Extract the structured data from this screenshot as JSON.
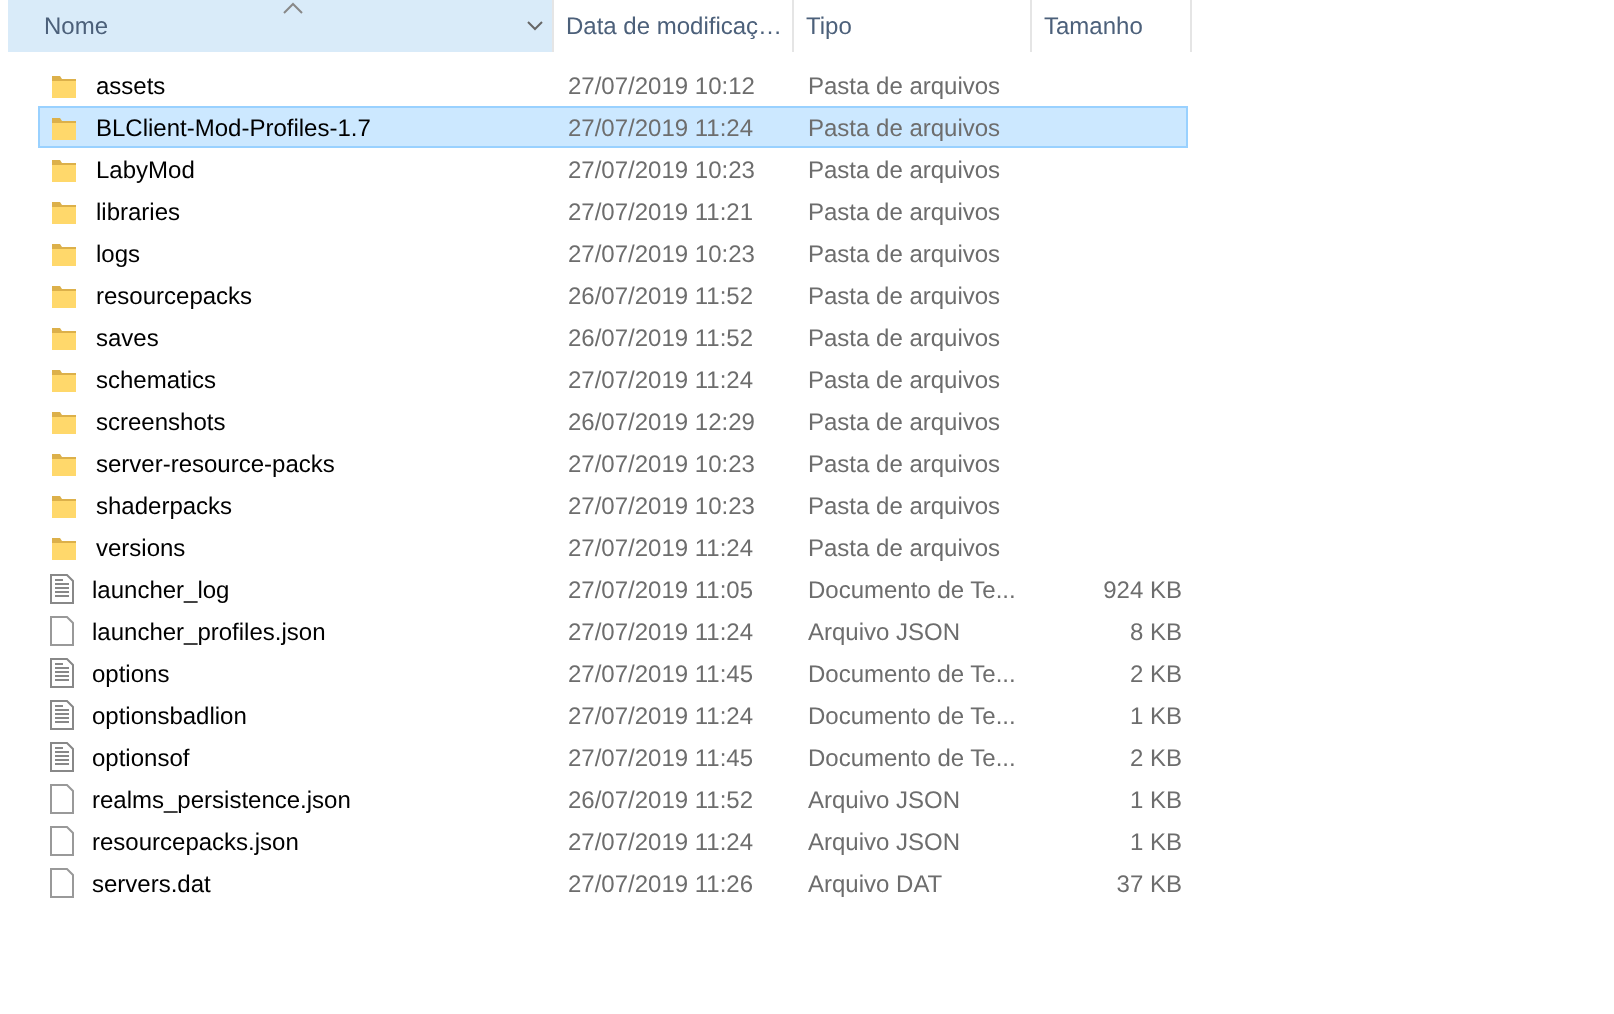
{
  "columns": [
    {
      "label": "Nome",
      "sorted": true
    },
    {
      "label": "Data de modificaç…",
      "sorted": false
    },
    {
      "label": "Tipo",
      "sorted": false
    },
    {
      "label": "Tamanho",
      "sorted": false
    }
  ],
  "rows": [
    {
      "kind": "folder",
      "name": "assets",
      "date": "27/07/2019 10:12",
      "type": "Pasta de arquivos",
      "selected": false
    },
    {
      "kind": "folder",
      "name": "BLClient-Mod-Profiles-1.7",
      "date": "27/07/2019 11:24",
      "type": "Pasta de arquivos",
      "selected": true
    },
    {
      "kind": "folder",
      "name": "LabyMod",
      "date": "27/07/2019 10:23",
      "type": "Pasta de arquivos",
      "selected": false
    },
    {
      "kind": "folder",
      "name": "libraries",
      "date": "27/07/2019 11:21",
      "type": "Pasta de arquivos",
      "selected": false
    },
    {
      "kind": "folder",
      "name": "logs",
      "date": "27/07/2019 10:23",
      "type": "Pasta de arquivos",
      "selected": false
    },
    {
      "kind": "folder",
      "name": "resourcepacks",
      "date": "26/07/2019 11:52",
      "type": "Pasta de arquivos",
      "selected": false
    },
    {
      "kind": "folder",
      "name": "saves",
      "date": "26/07/2019 11:52",
      "type": "Pasta de arquivos",
      "selected": false
    },
    {
      "kind": "folder",
      "name": "schematics",
      "date": "27/07/2019 11:24",
      "type": "Pasta de arquivos",
      "selected": false
    },
    {
      "kind": "folder",
      "name": "screenshots",
      "date": "26/07/2019 12:29",
      "type": "Pasta de arquivos",
      "selected": false
    },
    {
      "kind": "folder",
      "name": "server-resource-packs",
      "date": "27/07/2019 10:23",
      "type": "Pasta de arquivos",
      "selected": false
    },
    {
      "kind": "folder",
      "name": "shaderpacks",
      "date": "27/07/2019 10:23",
      "type": "Pasta de arquivos",
      "selected": false
    },
    {
      "kind": "folder",
      "name": "versions",
      "date": "27/07/2019 11:24",
      "type": "Pasta de arquivos",
      "selected": false
    },
    {
      "kind": "text",
      "name": "launcher_log",
      "date": "27/07/2019 11:05",
      "type": "Documento de Te...",
      "size": "924 KB",
      "selected": false
    },
    {
      "kind": "file",
      "name": "launcher_profiles.json",
      "date": "27/07/2019 11:24",
      "type": "Arquivo JSON",
      "size": "8 KB",
      "selected": false
    },
    {
      "kind": "text",
      "name": "options",
      "date": "27/07/2019 11:45",
      "type": "Documento de Te...",
      "size": "2 KB",
      "selected": false
    },
    {
      "kind": "text",
      "name": "optionsbadlion",
      "date": "27/07/2019 11:24",
      "type": "Documento de Te...",
      "size": "1 KB",
      "selected": false
    },
    {
      "kind": "text",
      "name": "optionsof",
      "date": "27/07/2019 11:45",
      "type": "Documento de Te...",
      "size": "2 KB",
      "selected": false
    },
    {
      "kind": "file",
      "name": "realms_persistence.json",
      "date": "26/07/2019 11:52",
      "type": "Arquivo JSON",
      "size": "1 KB",
      "selected": false
    },
    {
      "kind": "file",
      "name": "resourcepacks.json",
      "date": "27/07/2019 11:24",
      "type": "Arquivo JSON",
      "size": "1 KB",
      "selected": false
    },
    {
      "kind": "file",
      "name": "servers.dat",
      "date": "27/07/2019 11:26",
      "type": "Arquivo DAT",
      "size": "37 KB",
      "selected": false
    }
  ]
}
